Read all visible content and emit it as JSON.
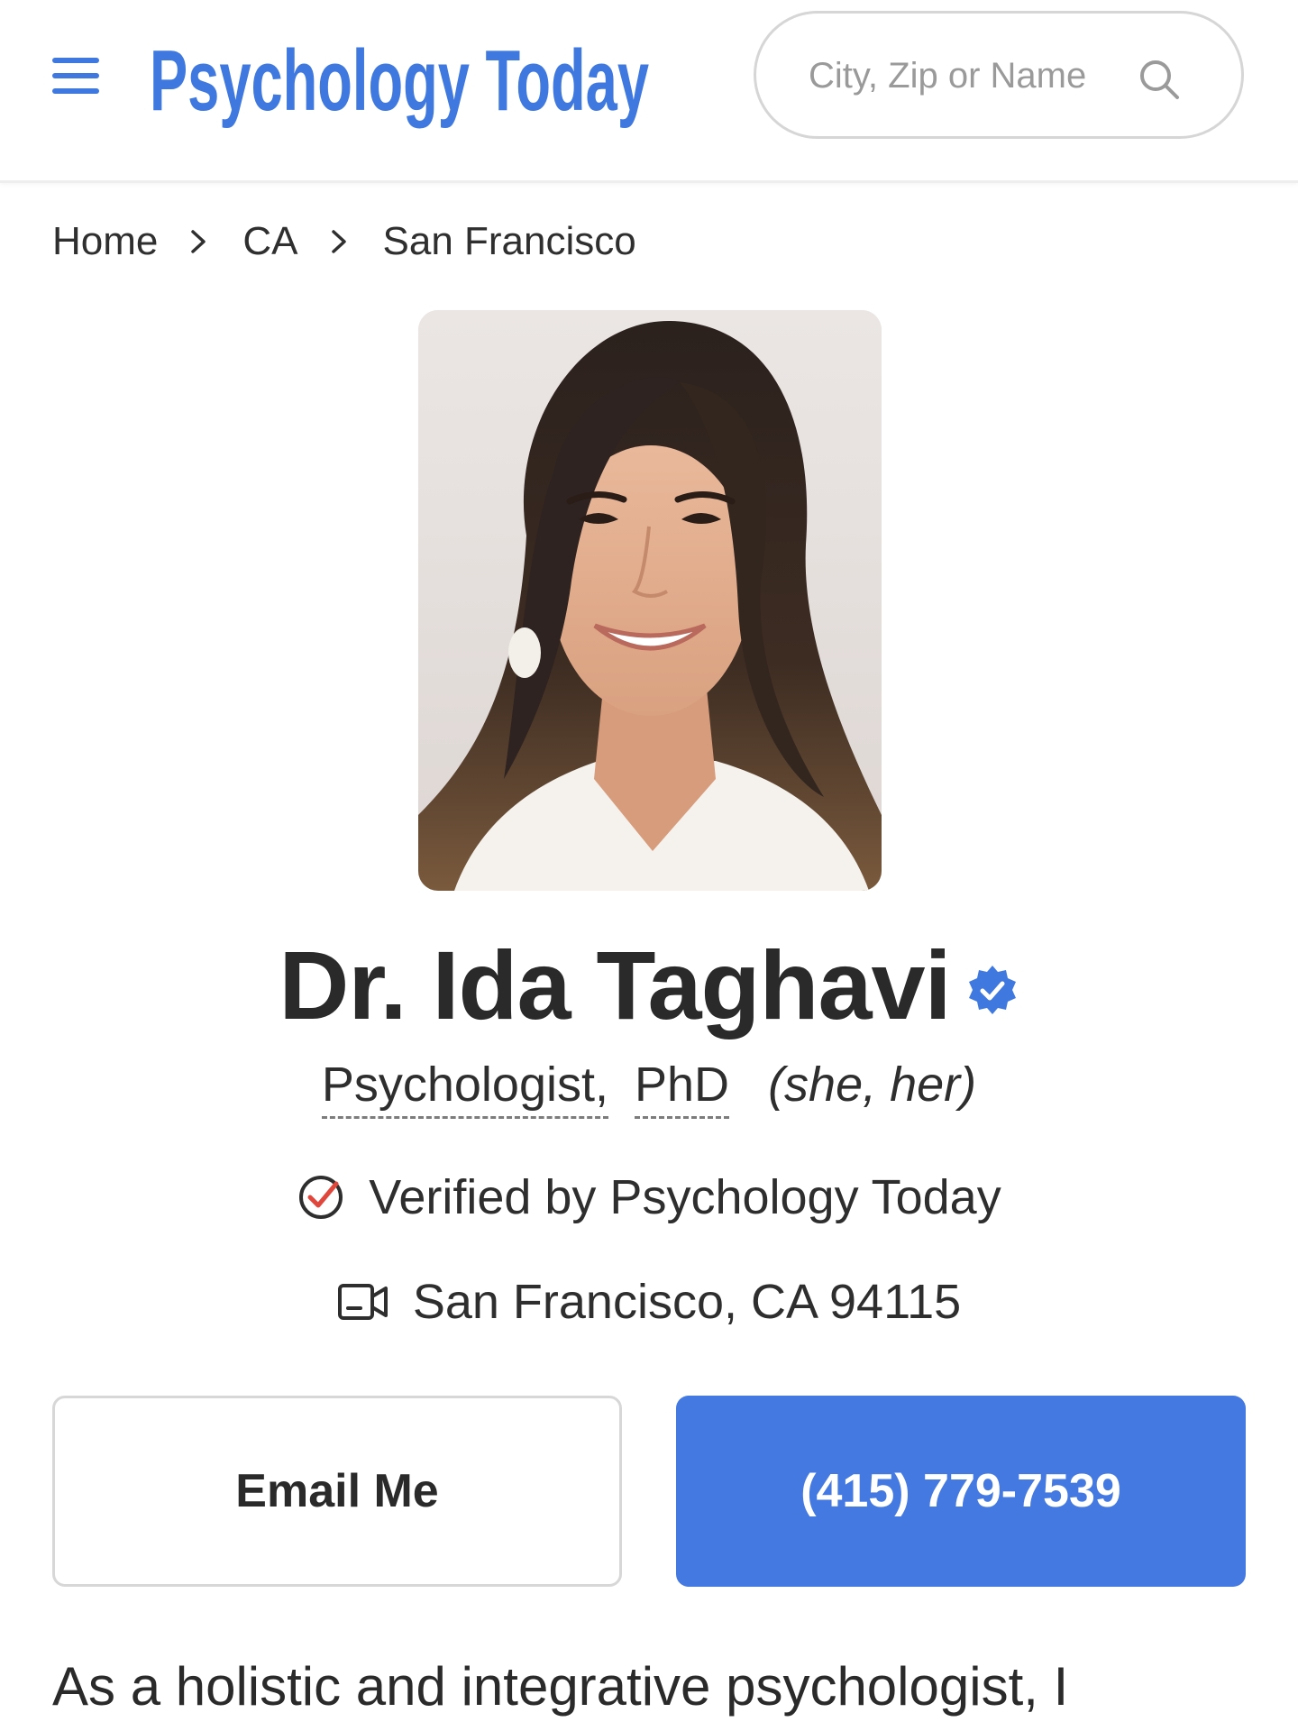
{
  "header": {
    "menu_icon": "hamburger-menu-icon",
    "logo_text": "Psychology Today",
    "brand_color": "#3f78de",
    "search": {
      "placeholder": "City, Zip or Name",
      "icon": "search-icon"
    }
  },
  "breadcrumb": {
    "items": [
      "Home",
      "CA",
      "San Francisco"
    ]
  },
  "profile": {
    "photo_alt": "Dr. Ida Taghavi",
    "name": "Dr. Ida Taghavi",
    "credential_title": "Psychologist,",
    "credential_degree": "PhD",
    "pronouns": "(she, her)",
    "verified_text": "Verified by Psychology Today",
    "location": "San Francisco, CA 94115"
  },
  "actions": {
    "email_label": "Email Me",
    "phone_label": "(415) 779-7539",
    "phone_color": "#4479e1"
  },
  "bio": {
    "text": "As a holistic and integrative psychologist, I"
  }
}
